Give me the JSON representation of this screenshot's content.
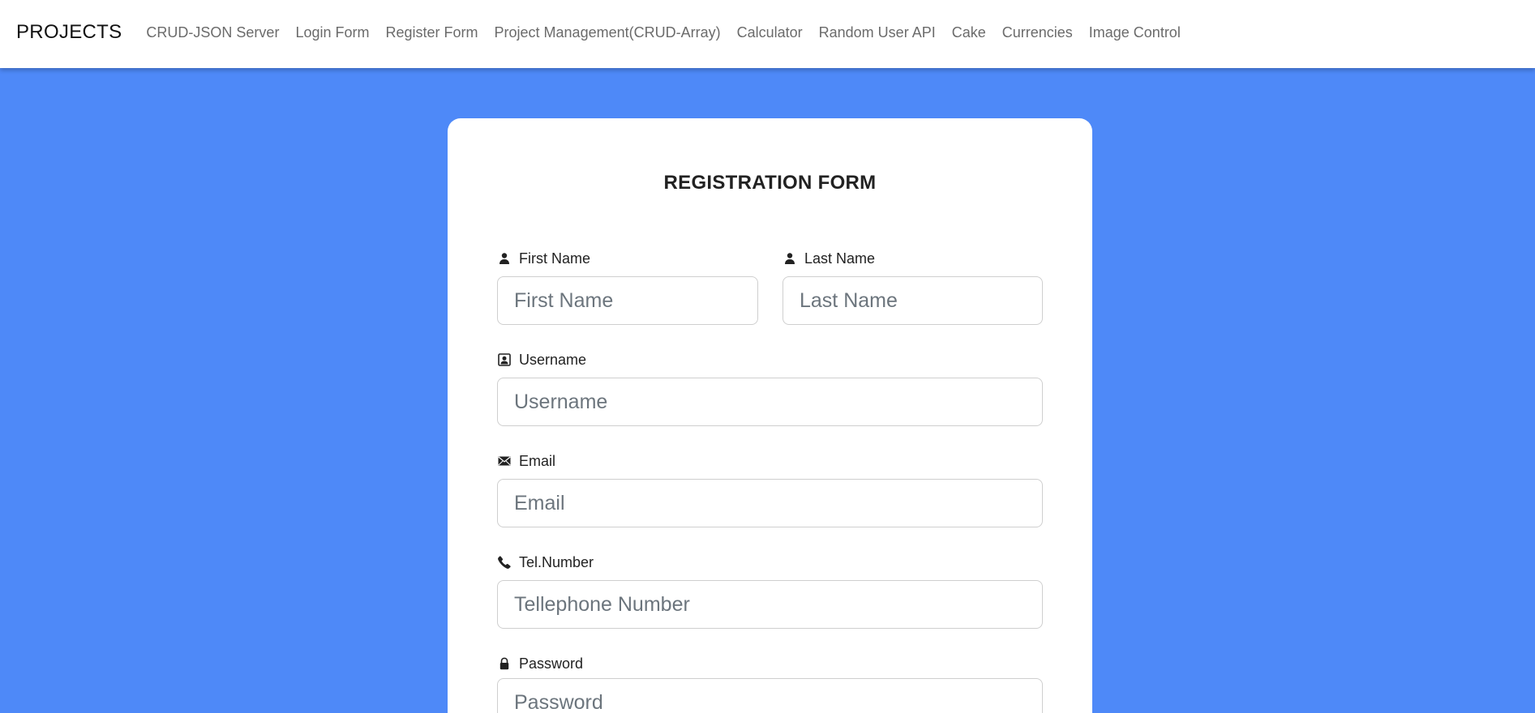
{
  "navbar": {
    "brand": "PROJECTS",
    "links": [
      "CRUD-JSON Server",
      "Login Form",
      "Register Form",
      "Project Management(CRUD-Array)",
      "Calculator",
      "Random User API",
      "Cake",
      "Currencies",
      "Image Control"
    ]
  },
  "form": {
    "title": "REGISTRATION FORM",
    "first_name": {
      "label": "First Name",
      "placeholder": "First Name",
      "icon": "person-icon"
    },
    "last_name": {
      "label": "Last Name",
      "placeholder": "Last Name",
      "icon": "person-icon"
    },
    "username": {
      "label": "Username",
      "placeholder": "Username",
      "icon": "person-badge-icon"
    },
    "email": {
      "label": "Email",
      "placeholder": "Email",
      "icon": "envelope-icon"
    },
    "tel": {
      "label": "Tel.Number",
      "placeholder": "Tellephone Number",
      "icon": "phone-icon"
    },
    "password": {
      "label": "Password",
      "placeholder": "Password",
      "icon": "lock-icon"
    }
  },
  "colors": {
    "page_background": "#4e89f8",
    "card_background": "#ffffff",
    "nav_link": "#6b6b6b"
  }
}
